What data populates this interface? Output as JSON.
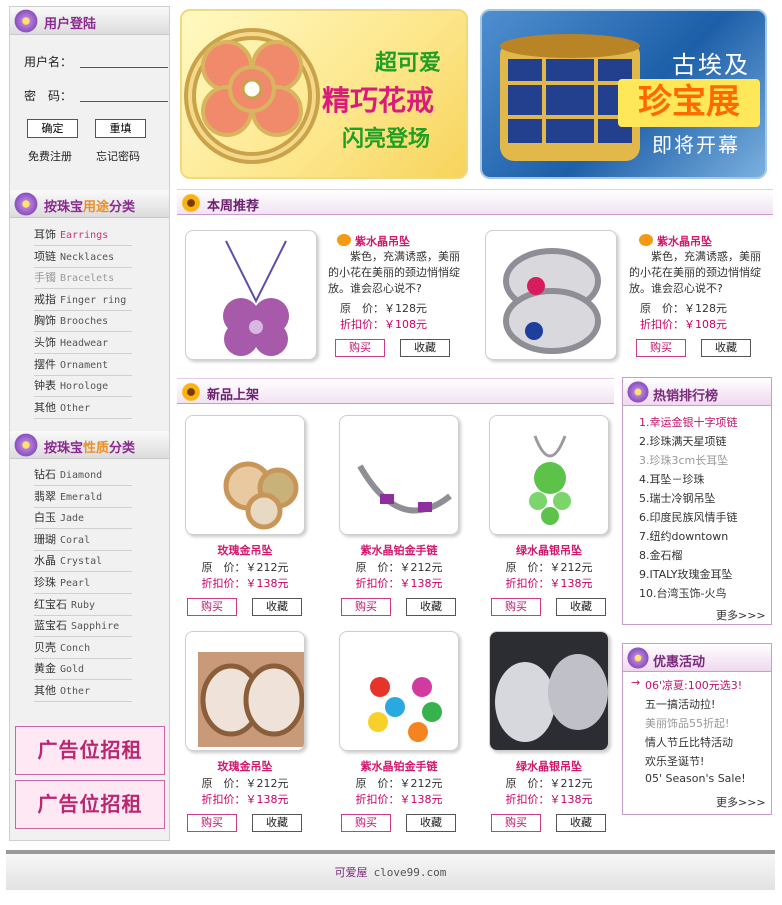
{
  "login": {
    "title": "用户登陆",
    "username_label": "用户名：",
    "password_label": "密　码：",
    "confirm_btn": "确定",
    "reset_btn": "重填",
    "register_link": "免费注册",
    "forgot_link": "忘记密码"
  },
  "usage": {
    "title_pre": "按珠宝",
    "title_hl": "用途",
    "title_post": "分类",
    "items": [
      {
        "cn": "耳饰",
        "en": "Earrings"
      },
      {
        "cn": "项链",
        "en": "Necklaces"
      },
      {
        "cn": "手镯",
        "en": "Bracelets"
      },
      {
        "cn": "戒指",
        "en": "Finger ring"
      },
      {
        "cn": "胸饰",
        "en": "Brooches"
      },
      {
        "cn": "头饰",
        "en": "Headwear"
      },
      {
        "cn": "摆件",
        "en": "Ornament"
      },
      {
        "cn": "钟表",
        "en": "Horologe"
      },
      {
        "cn": "其他",
        "en": "Other"
      }
    ]
  },
  "material": {
    "title_pre": "按珠宝",
    "title_hl": "性质",
    "title_post": "分类",
    "items": [
      {
        "cn": "钻石",
        "en": "Diamond"
      },
      {
        "cn": "翡翠",
        "en": "Emerald"
      },
      {
        "cn": "白玉",
        "en": "Jade"
      },
      {
        "cn": "珊瑚",
        "en": "Coral"
      },
      {
        "cn": "水晶",
        "en": "Crystal"
      },
      {
        "cn": "珍珠",
        "en": "Pearl"
      },
      {
        "cn": "红宝石",
        "en": "Ruby"
      },
      {
        "cn": "蓝宝石",
        "en": "Sapphire"
      },
      {
        "cn": "贝壳",
        "en": "Conch"
      },
      {
        "cn": "黄金",
        "en": "Gold"
      },
      {
        "cn": "其他",
        "en": "Other"
      }
    ]
  },
  "ads": [
    "广告位招租",
    "广告位招租"
  ],
  "banners": {
    "left": {
      "line1": "超可爱",
      "line2": "精巧花戒",
      "line3": "闪亮登场"
    },
    "right": {
      "line1": "古埃及",
      "line2": "珍宝展",
      "line3": "即将开幕"
    }
  },
  "weekly": {
    "title": "本周推荐",
    "items": [
      {
        "name": "紫水晶吊坠",
        "desc": "紫色，充满诱惑，美丽的小花在美丽的颈边悄悄绽放。谁会忍心说不?",
        "price": "原　价：￥128元",
        "discount": "折扣价：￥108元",
        "buy": "购买",
        "fav": "收藏"
      },
      {
        "name": "紫水晶吊坠",
        "desc": "紫色，充满诱惑，美丽的小花在美丽的颈边悄悄绽放。谁会忍心说不?",
        "price": "原　价：￥128元",
        "discount": "折扣价：￥108元",
        "buy": "购买",
        "fav": "收藏"
      }
    ]
  },
  "newarrivals": {
    "title": "新品上架",
    "items": [
      {
        "name": "玫瑰金吊坠",
        "price": "原　价：￥212元",
        "discount": "折扣价：￥138元",
        "buy": "购买",
        "fav": "收藏"
      },
      {
        "name": "紫水晶铂金手链",
        "price": "原　价：￥212元",
        "discount": "折扣价：￥138元",
        "buy": "购买",
        "fav": "收藏"
      },
      {
        "name": "绿水晶银吊坠",
        "price": "原　价：￥212元",
        "discount": "折扣价：￥138元",
        "buy": "购买",
        "fav": "收藏"
      },
      {
        "name": "玫瑰金吊坠",
        "price": "原　价：￥212元",
        "discount": "折扣价：￥138元",
        "buy": "购买",
        "fav": "收藏"
      },
      {
        "name": "紫水晶铂金手链",
        "price": "原　价：￥212元",
        "discount": "折扣价：￥138元",
        "buy": "购买",
        "fav": "收藏"
      },
      {
        "name": "绿水晶银吊坠",
        "price": "原　价：￥212元",
        "discount": "折扣价：￥138元",
        "buy": "购买",
        "fav": "收藏"
      }
    ]
  },
  "hot": {
    "title": "热销排行榜",
    "items": [
      "1.幸运金银十字项链",
      "2.珍珠满天星项链",
      "3.珍珠3cm长耳坠",
      "4.耳坠－珍珠",
      "5.瑞士冷钢吊坠",
      "6.印度民族风情手链",
      "7.纽约downtown",
      "8.金石榴",
      "9.ITALY玫瑰金耳坠",
      "10.台湾玉饰-火鸟"
    ],
    "more": "更多>>>"
  },
  "promo": {
    "title": "优惠活动",
    "items": [
      "06'凉夏:100元选3!",
      "五一搞活动拉!",
      "美丽饰品55折起!",
      "情人节丘比特活动",
      "欢乐圣诞节!",
      "05' Season's Sale!"
    ],
    "more": "更多>>>"
  },
  "footer": {
    "name": "可爱屋",
    "domain": "clove99.com"
  },
  "colors": {
    "accent": "#c0136d",
    "heading": "#7a2a7c",
    "highlight": "#e8902a"
  }
}
